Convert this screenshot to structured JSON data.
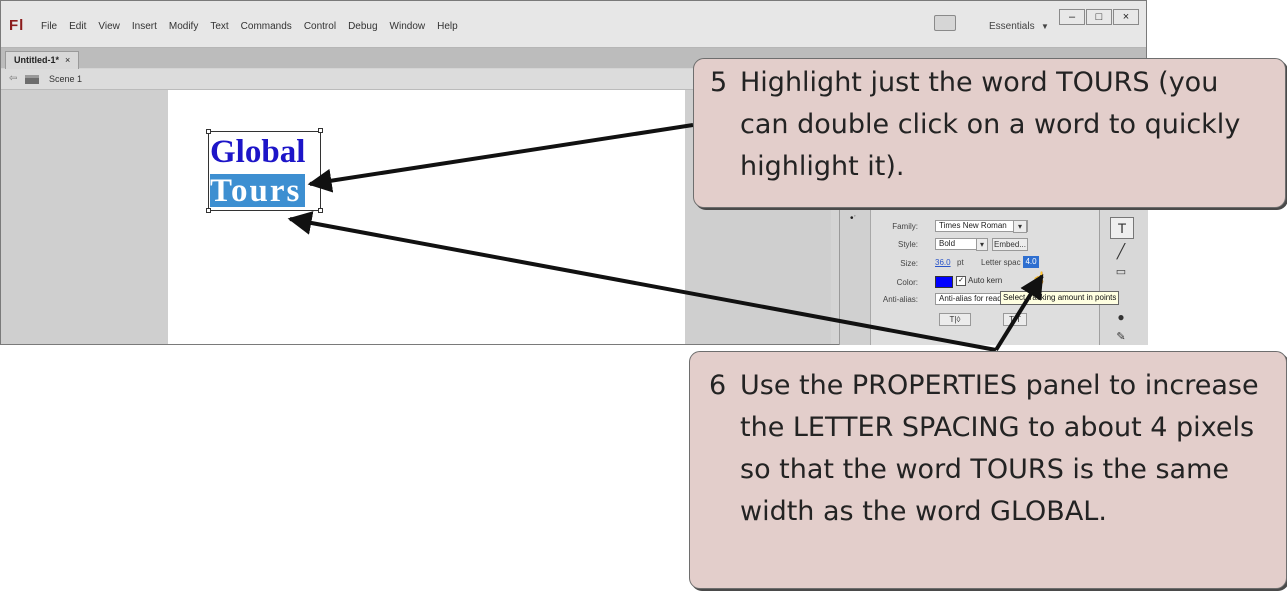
{
  "app": {
    "logo": "Fl",
    "menu": [
      "File",
      "Edit",
      "View",
      "Insert",
      "Modify",
      "Text",
      "Commands",
      "Control",
      "Debug",
      "Window",
      "Help"
    ],
    "workspace_label": "Essentials",
    "window_controls": [
      "–",
      "□",
      "×"
    ]
  },
  "tabs": {
    "document_tab": "Untitled-1*",
    "close": "×"
  },
  "scene": {
    "label": "Scene 1"
  },
  "stage": {
    "text_line1": "Global",
    "text_line2": "Tours"
  },
  "properties": {
    "family_label": "Family:",
    "family_value": "Times New Roman",
    "style_label": "Style:",
    "style_value": "Bold",
    "embed_button": "Embed...",
    "size_label": "Size:",
    "size_value": "36.0",
    "size_unit": "pt",
    "letter_spacing_label": "Letter spacing:",
    "letter_spacing_value": "4.0",
    "color_label": "Color:",
    "color_value": "#0000ff",
    "auto_kern_label": "Auto kern",
    "anti_alias_label": "Anti-alias:",
    "anti_alias_value": "Anti-alias for readability",
    "tooltip": "Select tracking amount in points"
  },
  "callouts": {
    "step5_number": "5",
    "step5_text": "Highlight just the word TOURS (you can double click on a word to quickly highlight it).",
    "step6_number": "6",
    "step6_text": "Use the PROPERTIES panel to increase the LETTER SPACING to about 4 pixels so that the word TOURS is the same width as the word GLOBAL."
  },
  "colors": {
    "callout_fill": "#e3cecb",
    "text_blue": "#1d15c8",
    "selection_blue": "#3d8fd1"
  }
}
